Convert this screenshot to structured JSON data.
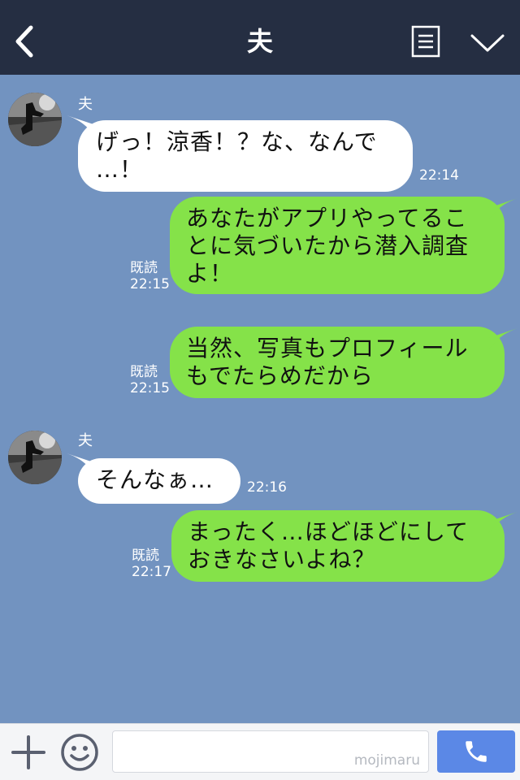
{
  "header": {
    "title": "夫"
  },
  "messages": [
    {
      "sender": "夫",
      "lines": [
        "げっ！涼香！？な、なんで",
        "…！"
      ],
      "time": "22:14"
    },
    {
      "lines": [
        "あなたがアプリやってるこ",
        "とに気づいたから潜入調査",
        "よ！"
      ],
      "read": "既読",
      "time": "22:15"
    },
    {
      "lines": [
        "当然、写真もプロフィール",
        "もでたらめだから"
      ],
      "read": "既読",
      "time": "22:15"
    },
    {
      "sender": "夫",
      "lines": [
        "そんなぁ…"
      ],
      "time": "22:16"
    },
    {
      "lines": [
        "まったく…ほどほどにして",
        "おきなさいよね？"
      ],
      "read": "既読",
      "time": "22:17"
    }
  ],
  "footer": {
    "watermark": "mojimaru"
  },
  "colors": {
    "header": "#252e42",
    "background": "#7293c0",
    "outgoing": "#85e249",
    "incoming": "#ffffff",
    "call": "#5b88e6"
  }
}
